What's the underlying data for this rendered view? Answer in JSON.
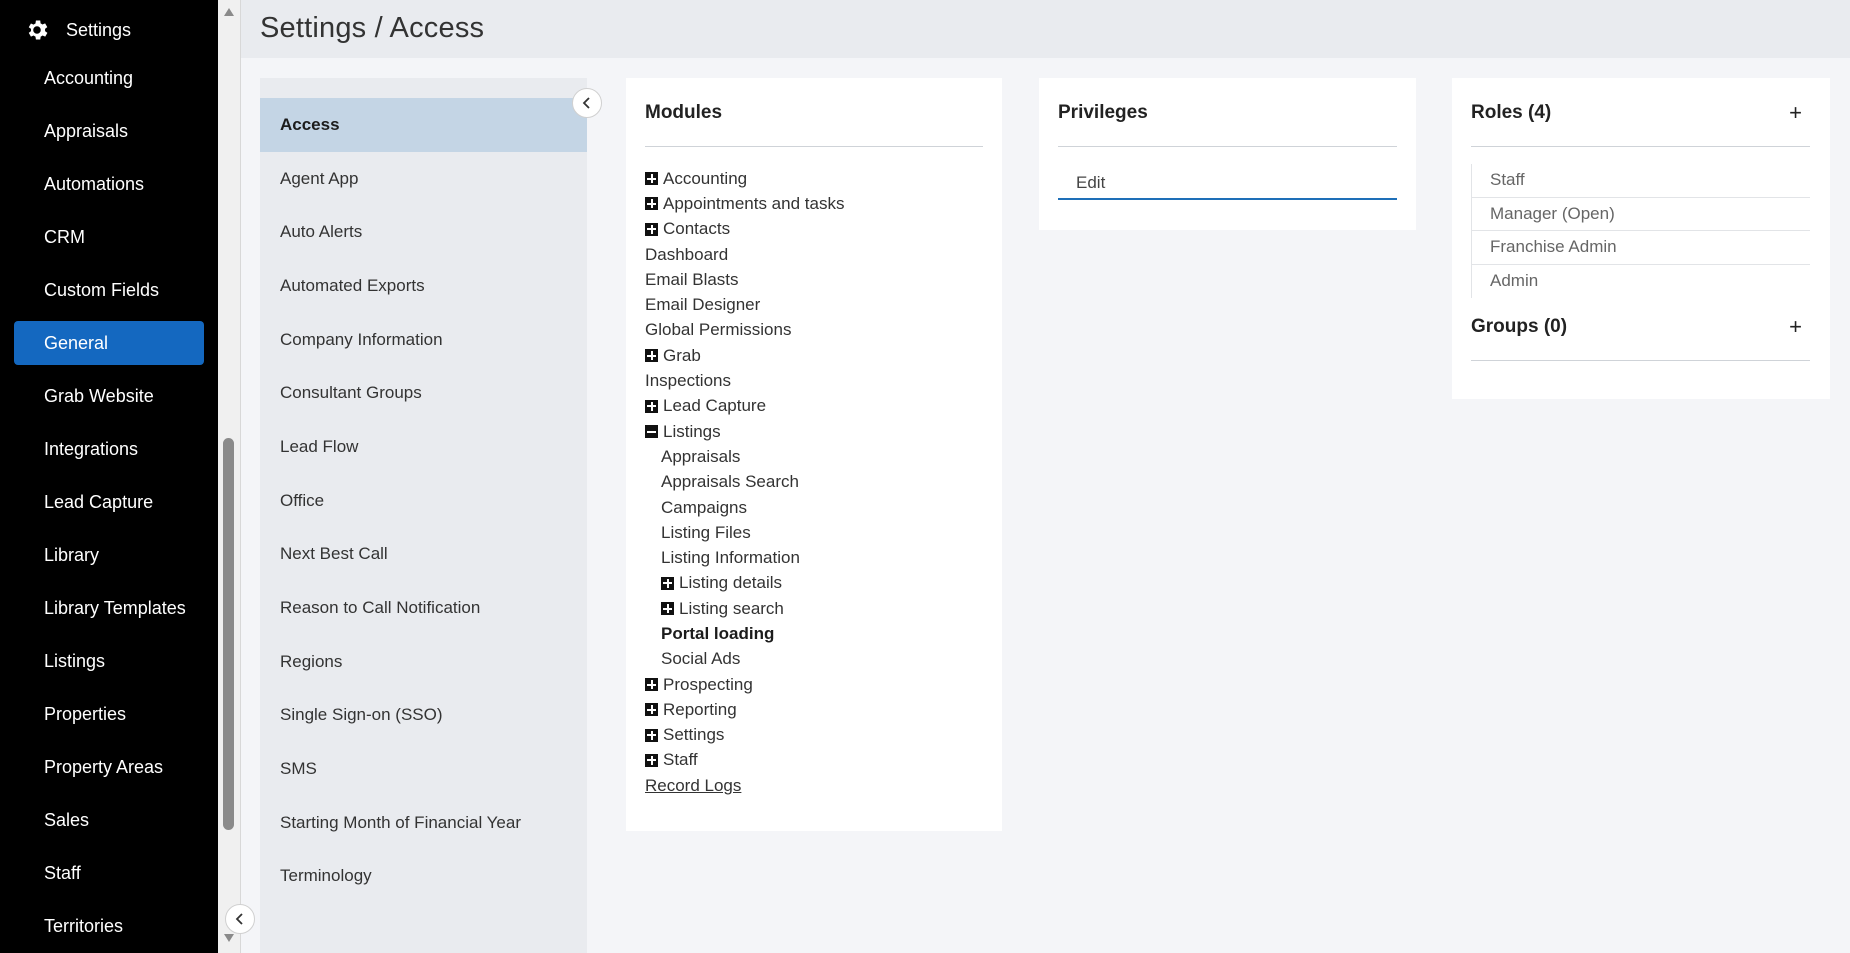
{
  "sidebar": {
    "title": "Settings",
    "icon": "gear-icon",
    "items": [
      {
        "label": "Accounting"
      },
      {
        "label": "Appraisals"
      },
      {
        "label": "Automations"
      },
      {
        "label": "CRM"
      },
      {
        "label": "Custom Fields"
      },
      {
        "label": "General",
        "active": true
      },
      {
        "label": "Grab Website"
      },
      {
        "label": "Integrations"
      },
      {
        "label": "Lead Capture"
      },
      {
        "label": "Library"
      },
      {
        "label": "Library Templates"
      },
      {
        "label": "Listings"
      },
      {
        "label": "Properties"
      },
      {
        "label": "Property Areas"
      },
      {
        "label": "Sales"
      },
      {
        "label": "Staff"
      },
      {
        "label": "Territories"
      }
    ]
  },
  "header": {
    "title": "Settings / Access"
  },
  "submenu": {
    "items": [
      {
        "label": "Access",
        "active": true
      },
      {
        "label": "Agent App"
      },
      {
        "label": "Auto Alerts"
      },
      {
        "label": "Automated Exports"
      },
      {
        "label": "Company Information"
      },
      {
        "label": "Consultant Groups"
      },
      {
        "label": "Lead Flow"
      },
      {
        "label": "Office"
      },
      {
        "label": "Next Best Call"
      },
      {
        "label": "Reason to Call Notification"
      },
      {
        "label": "Regions"
      },
      {
        "label": "Single Sign-on (SSO)"
      },
      {
        "label": "SMS"
      },
      {
        "label": "Starting Month of Financial Year"
      },
      {
        "label": "Terminology"
      }
    ]
  },
  "modules": {
    "title": "Modules",
    "tree": [
      {
        "label": "Accounting",
        "toggle": "plus"
      },
      {
        "label": "Appointments and tasks",
        "toggle": "plus"
      },
      {
        "label": "Contacts",
        "toggle": "plus"
      },
      {
        "label": "Dashboard"
      },
      {
        "label": "Email Blasts"
      },
      {
        "label": "Email Designer"
      },
      {
        "label": "Global Permissions"
      },
      {
        "label": "Grab",
        "toggle": "plus"
      },
      {
        "label": "Inspections"
      },
      {
        "label": "Lead Capture",
        "toggle": "plus"
      },
      {
        "label": "Listings",
        "toggle": "minus"
      },
      {
        "label": "Appraisals",
        "child": true
      },
      {
        "label": "Appraisals Search",
        "child": true
      },
      {
        "label": "Campaigns",
        "child": true
      },
      {
        "label": "Listing Files",
        "child": true
      },
      {
        "label": "Listing Information",
        "child": true
      },
      {
        "label": "Listing details",
        "child": true,
        "toggle": "plus"
      },
      {
        "label": "Listing search",
        "child": true,
        "toggle": "plus"
      },
      {
        "label": "Portal loading",
        "child": true,
        "selected": true
      },
      {
        "label": "Social Ads",
        "child": true
      },
      {
        "label": "Prospecting",
        "toggle": "plus"
      },
      {
        "label": "Reporting",
        "toggle": "plus"
      },
      {
        "label": "Settings",
        "toggle": "plus"
      },
      {
        "label": "Staff",
        "toggle": "plus"
      },
      {
        "label": "Record Logs",
        "link": true
      }
    ]
  },
  "privileges": {
    "title": "Privileges",
    "items": [
      {
        "label": "Edit"
      }
    ]
  },
  "roles": {
    "title": "Roles (4)",
    "items": [
      {
        "label": "Staff"
      },
      {
        "label": "Manager (Open)"
      },
      {
        "label": "Franchise Admin"
      },
      {
        "label": "Admin"
      }
    ],
    "add_label": "+"
  },
  "groups": {
    "title": "Groups (0)",
    "add_label": "+"
  },
  "colors": {
    "sidebar_bg": "#000000",
    "active_nav": "#1468c0",
    "submenu_active": "#c4d5e5",
    "privilege_underline": "#1e6fb8"
  }
}
